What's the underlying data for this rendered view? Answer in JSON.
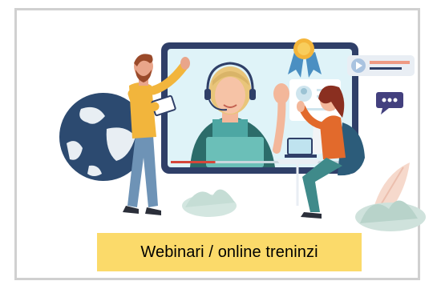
{
  "card": {
    "caption": "Webinari / online treninzi"
  },
  "colors": {
    "caption_background": "#fbda6a",
    "card_border": "#d0d0d0",
    "screen_frame": "#2f3f68",
    "screen_background": "#dff3f8",
    "accent_red": "#d6463a",
    "globe": "#2c4a70",
    "plant": "#b8d3ca"
  },
  "illustration": {
    "icons": [
      "globe-icon",
      "award-ribbon-icon",
      "video-play-icon",
      "chat-bubble-icon",
      "profile-card-icon",
      "laptop-icon",
      "headset-icon"
    ],
    "people": [
      "man-with-tablet",
      "woman-presenter-with-headset",
      "woman-in-chair-with-laptop"
    ],
    "video_progress": 0.25
  }
}
